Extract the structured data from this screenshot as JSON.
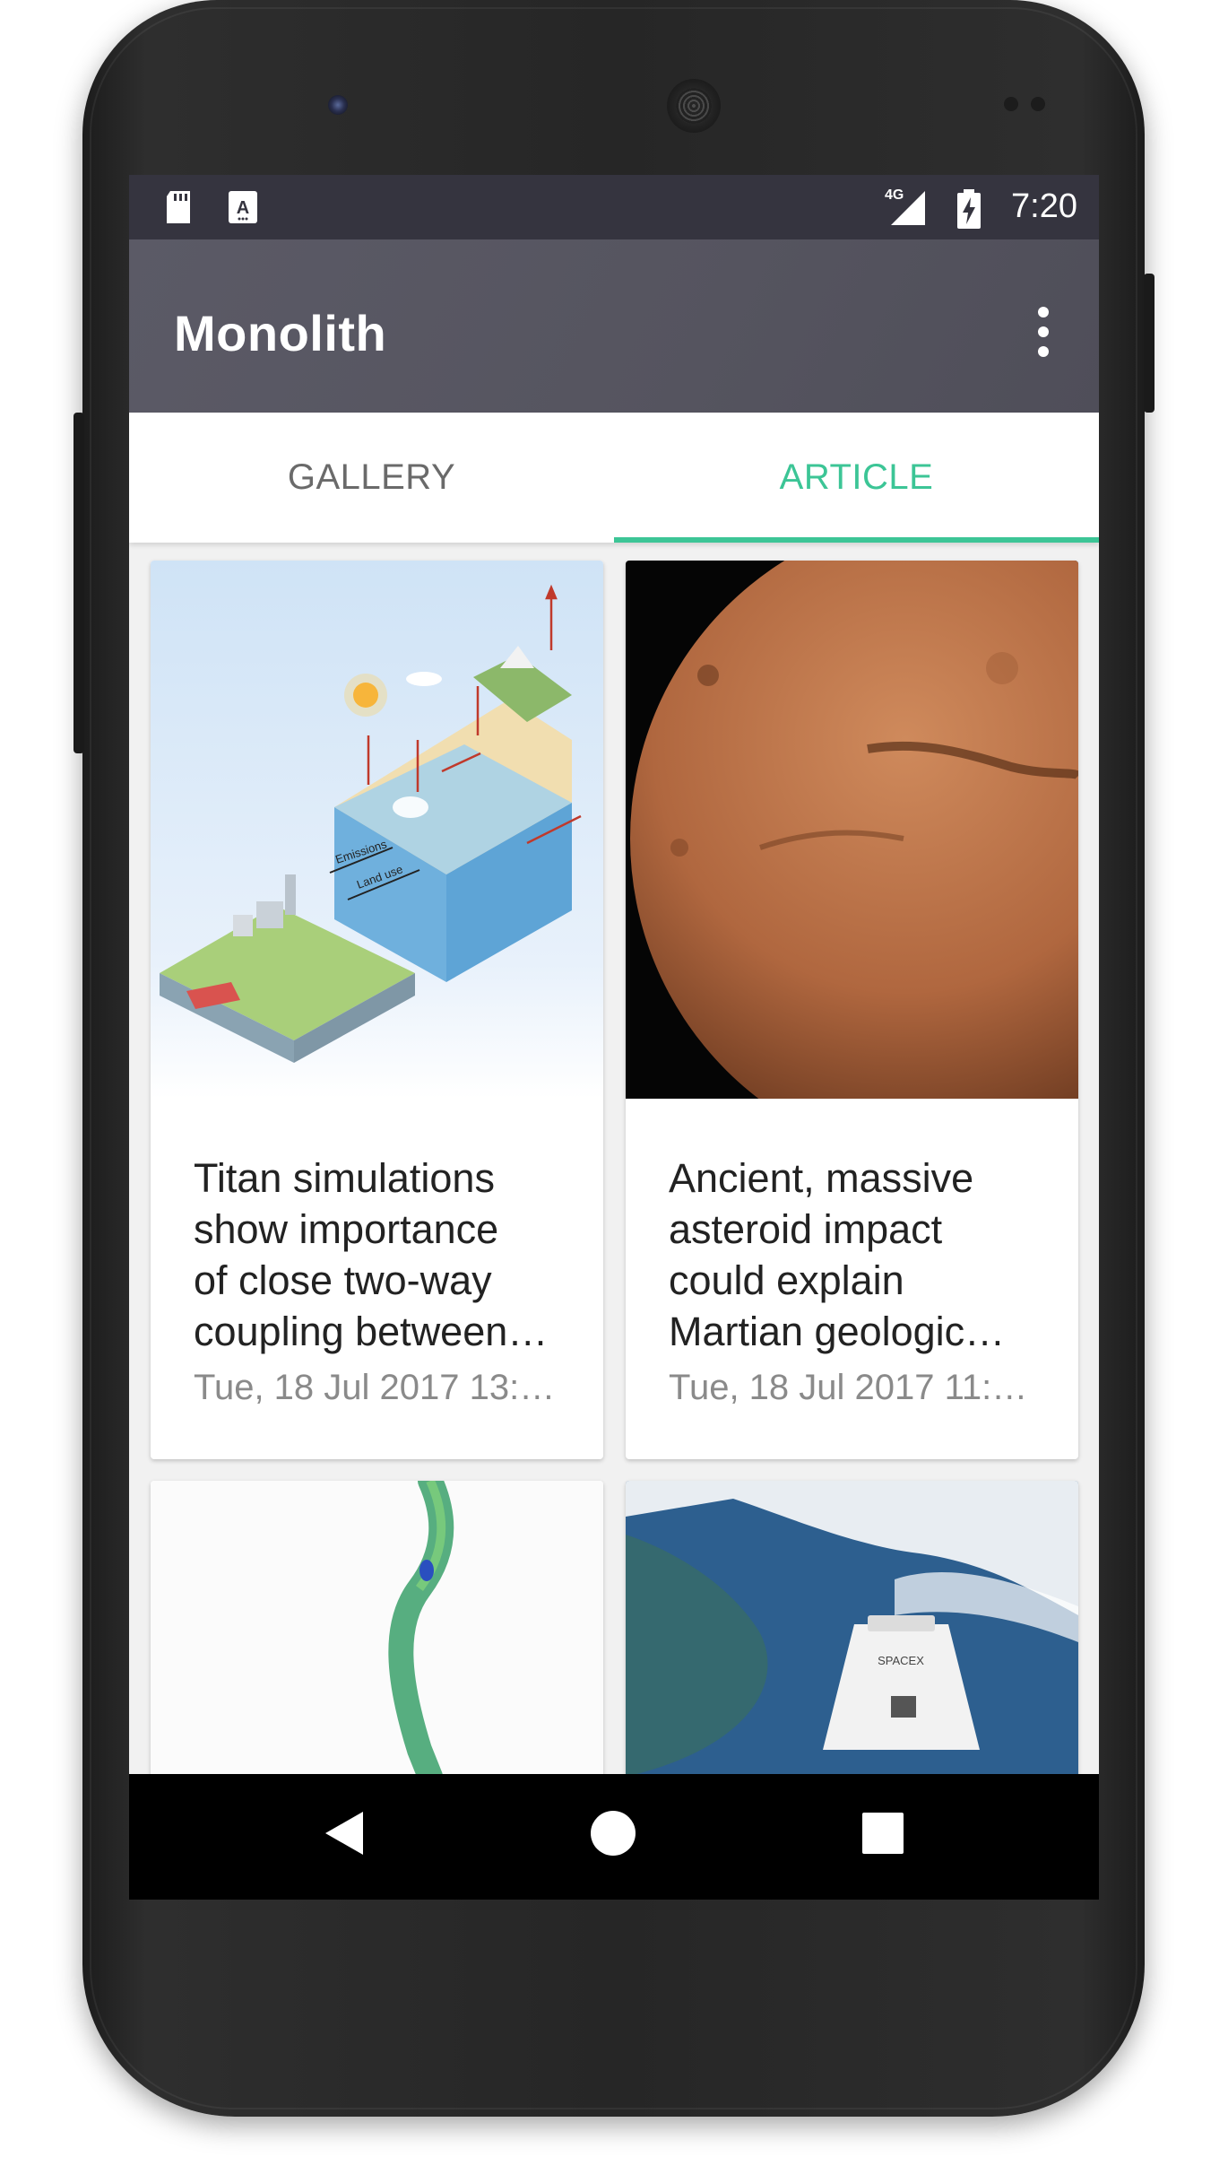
{
  "status_bar": {
    "time": "7:20",
    "network": "4G",
    "icons": [
      "sd-card-icon",
      "notification-a-icon",
      "signal-icon",
      "battery-charging-icon"
    ]
  },
  "app_bar": {
    "title": "Monolith",
    "menu_icon": "more-vert-icon"
  },
  "tabs": [
    {
      "label": "GALLERY",
      "active": false
    },
    {
      "label": "ARTICLE",
      "active": true
    }
  ],
  "accent_color": "#3cc596",
  "app_bar_color": "#55545f",
  "articles": [
    {
      "title_lines": [
        "Titan simulations",
        "show importance",
        "of close two-way",
        "coupling between…"
      ],
      "date": "Tue, 18 Jul 2017 13:…",
      "image": "climate-diagram",
      "image_labels": [
        "Emissions",
        "Land use"
      ]
    },
    {
      "title_lines": [
        "Ancient, massive",
        "asteroid impact",
        "could explain",
        "Martian geologic…"
      ],
      "date": "Tue, 18 Jul 2017 11:…",
      "image": "mars-planet"
    },
    {
      "image": "green-tendril"
    },
    {
      "image": "spacex-dragon-capsule",
      "image_labels": [
        "SPACEX"
      ]
    }
  ],
  "nav_bar": {
    "icons": [
      "back-icon",
      "home-icon",
      "recents-icon"
    ]
  }
}
